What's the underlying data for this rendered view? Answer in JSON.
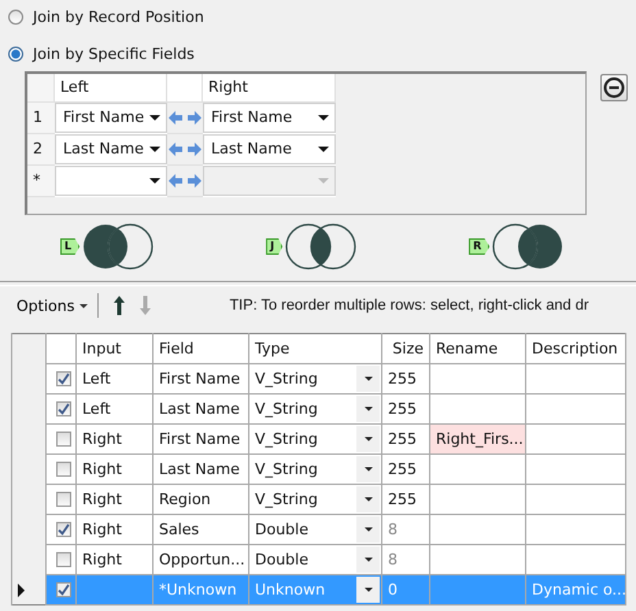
{
  "join_modes": [
    {
      "label": "Join by Record Position",
      "selected": false
    },
    {
      "label": "Join by Specific Fields",
      "selected": true
    }
  ],
  "join_fields": {
    "columns": [
      "Left",
      "Right"
    ],
    "rows": [
      {
        "index": "1",
        "left": "First Name",
        "right": "First Name",
        "right_disabled": false
      },
      {
        "index": "2",
        "left": "Last Name",
        "right": "Last Name",
        "right_disabled": false
      },
      {
        "index": "*",
        "left": "",
        "right": "",
        "right_disabled": true
      }
    ]
  },
  "join_outputs": [
    {
      "label": "L",
      "kind": "left"
    },
    {
      "label": "J",
      "kind": "inner"
    },
    {
      "label": "R",
      "kind": "right"
    }
  ],
  "toolbar": {
    "options": "Options",
    "up_disabled": false,
    "down_disabled": true,
    "tip": "TIP: To reorder multiple rows: select, right-click and dr"
  },
  "fields_table": {
    "columns": [
      "Input",
      "Field",
      "Type",
      "Size",
      "Rename",
      "Description"
    ],
    "rows": [
      {
        "checked": true,
        "input": "Left",
        "field": "First Name",
        "type": "V_String",
        "size": "255",
        "size_fixed": false,
        "rename": "",
        "rename_highlight": false,
        "description": "",
        "selected": false
      },
      {
        "checked": true,
        "input": "Left",
        "field": "Last Name",
        "type": "V_String",
        "size": "255",
        "size_fixed": false,
        "rename": "",
        "rename_highlight": false,
        "description": "",
        "selected": false
      },
      {
        "checked": false,
        "input": "Right",
        "field": "First Name",
        "type": "V_String",
        "size": "255",
        "size_fixed": false,
        "rename": "Right_Firs...",
        "rename_highlight": true,
        "description": "",
        "selected": false
      },
      {
        "checked": false,
        "input": "Right",
        "field": "Last Name",
        "type": "V_String",
        "size": "255",
        "size_fixed": false,
        "rename": "",
        "rename_highlight": false,
        "description": "",
        "selected": false
      },
      {
        "checked": false,
        "input": "Right",
        "field": "Region",
        "type": "V_String",
        "size": "255",
        "size_fixed": false,
        "rename": "",
        "rename_highlight": false,
        "description": "",
        "selected": false
      },
      {
        "checked": true,
        "input": "Right",
        "field": "Sales",
        "type": "Double",
        "size": "8",
        "size_fixed": true,
        "rename": "",
        "rename_highlight": false,
        "description": "",
        "selected": false
      },
      {
        "checked": false,
        "input": "Right",
        "field": "Opportun...",
        "type": "Double",
        "size": "8",
        "size_fixed": true,
        "rename": "",
        "rename_highlight": false,
        "description": "",
        "selected": false
      },
      {
        "checked": true,
        "input": "",
        "field": "*Unknown",
        "type": "Unknown",
        "size": "0",
        "size_fixed": false,
        "rename": "",
        "rename_highlight": false,
        "description": "Dynamic o...",
        "selected": true
      }
    ]
  }
}
